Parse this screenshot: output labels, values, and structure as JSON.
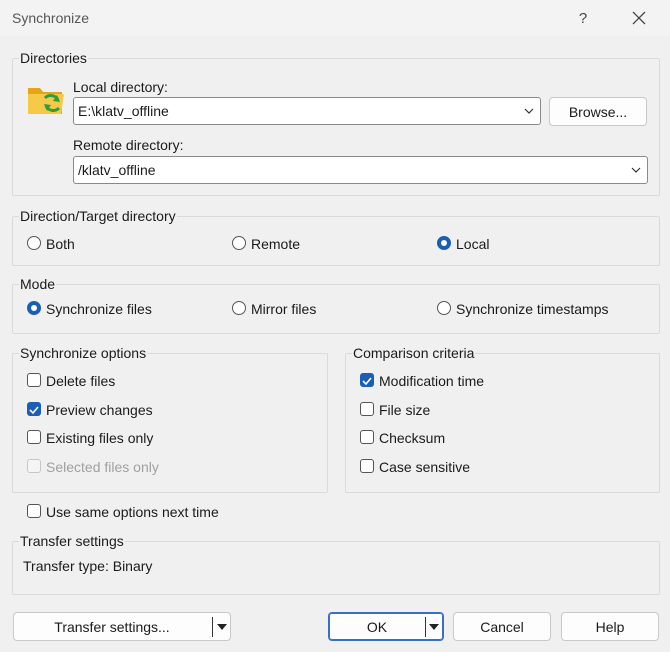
{
  "window": {
    "title": "Synchronize",
    "help_glyph": "?",
    "close_glyph": "✕"
  },
  "directories": {
    "legend": "Directories",
    "local_label": "Local directory:",
    "local_value": "E:\\klatv_offline",
    "browse_label": "Browse...",
    "remote_label": "Remote directory:",
    "remote_value": "/klatv_offline"
  },
  "direction": {
    "legend": "Direction/Target directory",
    "options": [
      {
        "label": "Both",
        "selected": false
      },
      {
        "label": "Remote",
        "selected": false
      },
      {
        "label": "Local",
        "selected": true
      }
    ]
  },
  "mode": {
    "legend": "Mode",
    "options": [
      {
        "label": "Synchronize files",
        "selected": true
      },
      {
        "label": "Mirror files",
        "selected": false
      },
      {
        "label": "Synchronize timestamps",
        "selected": false
      }
    ]
  },
  "sync_options": {
    "legend": "Synchronize options",
    "items": [
      {
        "label": "Delete files",
        "checked": false,
        "disabled": false
      },
      {
        "label": "Preview changes",
        "checked": true,
        "disabled": false
      },
      {
        "label": "Existing files only",
        "checked": false,
        "disabled": false
      },
      {
        "label": "Selected files only",
        "checked": false,
        "disabled": true
      }
    ]
  },
  "comparison": {
    "legend": "Comparison criteria",
    "items": [
      {
        "label": "Modification time",
        "checked": true
      },
      {
        "label": "File size",
        "checked": false
      },
      {
        "label": "Checksum",
        "checked": false
      },
      {
        "label": "Case sensitive",
        "checked": false
      }
    ]
  },
  "same_options": {
    "label": "Use same options next time",
    "checked": false
  },
  "transfer": {
    "legend": "Transfer settings",
    "text": "Transfer type: Binary"
  },
  "buttons": {
    "transfer_settings": "Transfer settings...",
    "ok": "OK",
    "cancel": "Cancel",
    "help": "Help"
  },
  "colors": {
    "accent": "#1a5fb4",
    "default_border": "#3a6fc7",
    "folder": "#f5b731",
    "sync_arrows": "#3aa63a"
  },
  "icons": {
    "folder": "folder-sync-icon",
    "dropdown": "chevron-down-icon",
    "split": "triangle-down-icon"
  }
}
